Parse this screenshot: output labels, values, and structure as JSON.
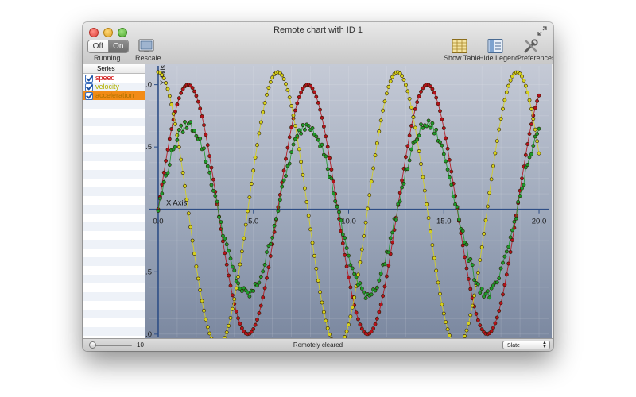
{
  "window": {
    "title": "Remote chart with ID 1"
  },
  "toolbar": {
    "toggle": {
      "off_label": "Off",
      "on_label": "On",
      "selected": "On"
    },
    "running_label": "Running",
    "rescale_label": "Rescale",
    "show_table_label": "Show Table",
    "hide_legend_label": "Hide Legend",
    "preferences_label": "Preferences"
  },
  "sidebar": {
    "header": "Series",
    "items": [
      {
        "label": "speed",
        "color": "#cc0000",
        "checked": true,
        "selected": false
      },
      {
        "label": "velocity",
        "color": "#b3b300",
        "checked": true,
        "selected": false
      },
      {
        "label": "acceleration",
        "color": "#b37400",
        "checked": true,
        "selected": true
      }
    ]
  },
  "bottom": {
    "slider_value": "10",
    "status": "Remotely cleared",
    "theme": "Slate"
  },
  "chart_data": {
    "type": "scatter",
    "xlabel": "X Axis",
    "ylabel": "Y Axis",
    "xlim": [
      -0.5,
      20.5
    ],
    "ylim": [
      -1.02,
      1.15
    ],
    "x_ticks": [
      "0.0",
      "5.0",
      "10.0",
      "15.0",
      "20.0"
    ],
    "y_tick_labels": [
      "1.0",
      "0.5",
      "",
      "-0.5",
      "-1.0"
    ],
    "y_tick_values": [
      1.0,
      0.5,
      0,
      -0.5,
      -1.0
    ],
    "grid": true,
    "series": [
      {
        "name": "speed",
        "color": "#b5121b",
        "fn": "sin",
        "amplitude": 1.0,
        "frequency": 1.0,
        "phase": 0.0,
        "noise": 0.0
      },
      {
        "name": "velocity",
        "color": "#d6d11e",
        "fn": "cos",
        "amplitude": 1.1,
        "frequency": 1.0,
        "phase": 0.0,
        "noise": 0.0
      },
      {
        "name": "acceleration",
        "color": "#1d9a2b",
        "fn": "sin",
        "amplitude": 0.68,
        "frequency": 1.0,
        "phase": 0.0,
        "noise": 0.04
      }
    ],
    "x_start": 0,
    "x_end": 20,
    "point_count": 200
  }
}
